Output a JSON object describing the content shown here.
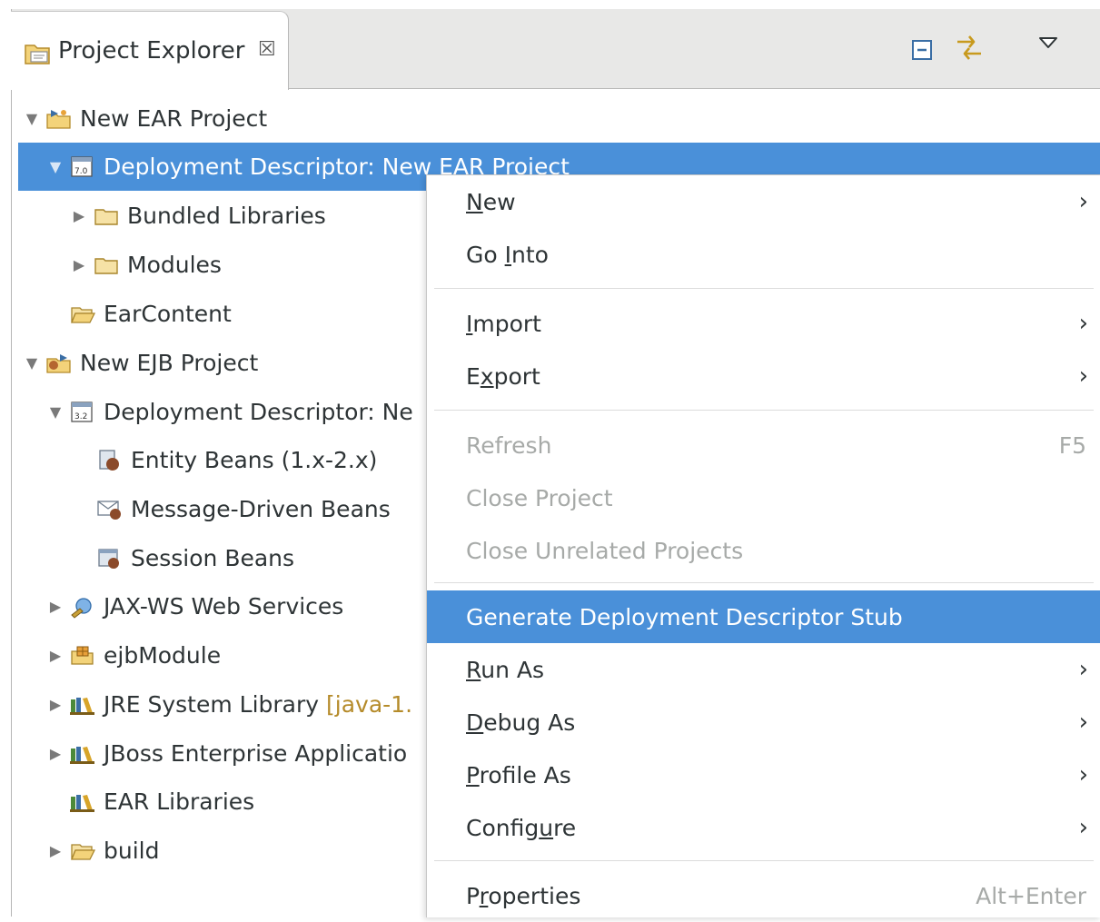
{
  "view": {
    "title": "Project Explorer",
    "close_glyph": "☒",
    "toolbar_icons": [
      "collapse-all-icon",
      "link-with-editor-icon",
      "view-menu-icon"
    ]
  },
  "tree": [
    {
      "label": "New EAR Project",
      "icon": "ear-project-icon",
      "expanded": true,
      "level": 0
    },
    {
      "label": "Deployment Descriptor: New EAR Project",
      "icon": "deployment-descriptor-icon",
      "expanded": true,
      "level": 1,
      "selected": true
    },
    {
      "label": "Bundled Libraries",
      "icon": "folder-icon",
      "expanded": false,
      "level": 2
    },
    {
      "label": "Modules",
      "icon": "folder-icon",
      "expanded": false,
      "level": 2
    },
    {
      "label": "EarContent",
      "icon": "open-folder-icon",
      "level": 1
    },
    {
      "label": "New EJB Project",
      "icon": "ejb-project-icon",
      "expanded": true,
      "level": 0
    },
    {
      "label": "Deployment Descriptor: Ne",
      "icon": "deployment-descriptor-icon",
      "expanded": true,
      "level": 1
    },
    {
      "label": "Entity Beans (1.x-2.x)",
      "icon": "entity-beans-icon",
      "level": 2
    },
    {
      "label": "Message-Driven Beans",
      "icon": "message-beans-icon",
      "level": 2
    },
    {
      "label": "Session Beans",
      "icon": "session-beans-icon",
      "level": 2
    },
    {
      "label": "JAX-WS Web Services",
      "icon": "web-services-icon",
      "expanded": false,
      "level": 1
    },
    {
      "label": "ejbModule",
      "icon": "package-folder-icon",
      "expanded": false,
      "level": 1
    },
    {
      "label": "JRE System Library",
      "decoration": "[java-1.",
      "icon": "library-icon",
      "expanded": false,
      "level": 1
    },
    {
      "label": "JBoss Enterprise Applicatio",
      "icon": "library-icon",
      "expanded": false,
      "level": 1
    },
    {
      "label": "EAR Libraries",
      "icon": "library-icon",
      "level": 1
    },
    {
      "label": "build",
      "icon": "open-folder-icon",
      "expanded": false,
      "level": 1
    }
  ],
  "context_menu": {
    "items": [
      {
        "pre": "",
        "mn": "N",
        "post": "ew",
        "submenu": true
      },
      {
        "pre": "Go ",
        "mn": "I",
        "post": "nto"
      },
      {
        "pre": "",
        "mn": "I",
        "post": "mport",
        "submenu": true
      },
      {
        "pre": "E",
        "mn": "x",
        "post": "port",
        "submenu": true
      },
      {
        "pre": "Refresh",
        "mn": "",
        "post": "",
        "accel": "F5",
        "disabled": true
      },
      {
        "pre": "Close Project",
        "mn": "",
        "post": "",
        "disabled": true
      },
      {
        "pre": "Close Unrelated Projects",
        "mn": "",
        "post": "",
        "disabled": true
      },
      {
        "pre": "Generate Deployment Descriptor Stub",
        "mn": "",
        "post": "",
        "active": true
      },
      {
        "pre": "",
        "mn": "R",
        "post": "un As",
        "submenu": true
      },
      {
        "pre": "",
        "mn": "D",
        "post": "ebug As",
        "submenu": true
      },
      {
        "pre": "",
        "mn": "P",
        "post": "rofile As",
        "submenu": true
      },
      {
        "pre": "Config",
        "mn": "u",
        "post": "re",
        "submenu": true
      },
      {
        "pre": "P",
        "mn": "r",
        "post": "operties",
        "accel": "Alt+Enter"
      }
    ],
    "submenu_glyph": "›"
  },
  "colors": {
    "selection": "#4a90d9",
    "disabled_text": "#a7aaa8",
    "decoration_text": "#b58b2a",
    "folder": "#e8c25a"
  }
}
